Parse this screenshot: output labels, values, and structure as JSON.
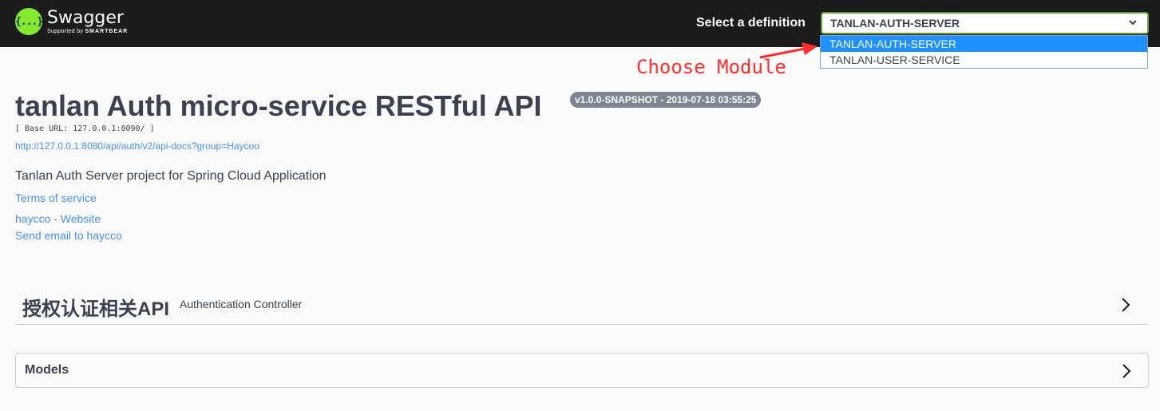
{
  "topbar": {
    "logo_icon": "{...}",
    "logo_name": "Swagger",
    "logo_sub_prefix": "Supported by",
    "logo_sub_brand": "SMARTBEAR",
    "select_label": "Select a definition",
    "selected_value": "TANLAN-AUTH-SERVER",
    "options": [
      "TANLAN-AUTH-SERVER",
      "TANLAN-USER-SERVICE"
    ]
  },
  "annotation": {
    "text": "Choose Module",
    "color": "#ff2d2d"
  },
  "info": {
    "title": "tanlan Auth micro-service RESTful API",
    "version": "v1.0.0-SNAPSHOT - 2019-07-18 03:55:25",
    "base_url": "[ Base URL: 127.0.0.1:8090/ ]",
    "api_docs_url": "http://127.0.0.1:8080/api/auth/v2/api-docs?group=Haycoo",
    "description": "Tanlan Auth Server project for Spring Cloud Application",
    "terms": "Terms of service",
    "website": "haycco - Website",
    "email": "Send email to haycco"
  },
  "tag": {
    "name": "授权认证相关API",
    "description": "Authentication Controller"
  },
  "models": {
    "title": "Models"
  },
  "colors": {
    "topbar": "#1b1b1b",
    "logo": "#85ea2d",
    "link": "#4990e2",
    "selected_option": "#1e90ff",
    "text": "#3b4151"
  }
}
